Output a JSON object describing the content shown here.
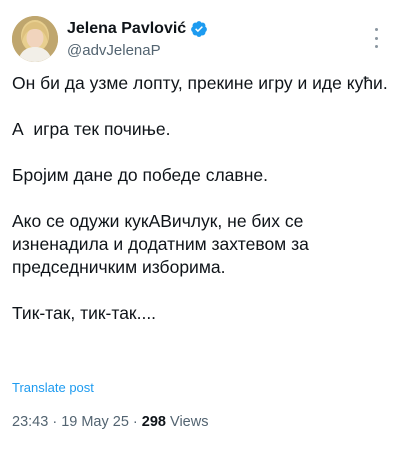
{
  "author": {
    "display_name": "Jelena Pavlović",
    "handle": "@advJelenaP",
    "verified": true,
    "verified_icon": "verified-badge-icon",
    "avatar": "avatar-photo"
  },
  "menu": {
    "icon": "more-vertical-icon"
  },
  "post": {
    "paragraphs": [
      "Он би да узме лопту, прекине игру и иде кући.",
      "А  игра тек почиње.",
      "Бројим дане до победе славне.",
      "Ако се одужи кукАВичлук, не бих се изненадила и додатним захтевом за председничким изборима.",
      "Тик-так, тик-так...."
    ],
    "translate_label": "Translate post"
  },
  "meta": {
    "time": "23:43",
    "sep1": " · ",
    "date": "19 May 25",
    "sep2": " · ",
    "views_count": "298",
    "views_label": " Views"
  },
  "colors": {
    "link": "#1d9bf0",
    "secondary_text": "#536471",
    "primary_text": "#0f1419",
    "verified": "#1d9bf0"
  }
}
